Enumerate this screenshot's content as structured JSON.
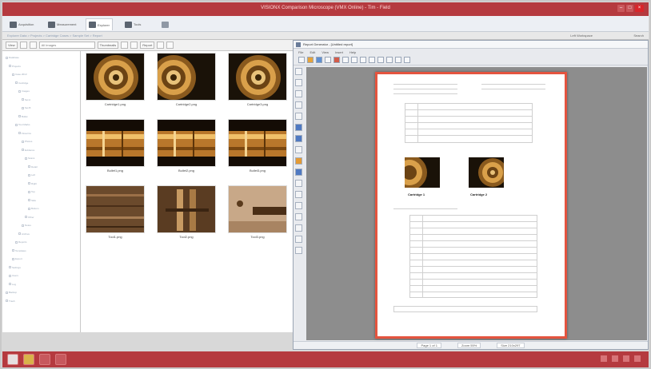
{
  "window": {
    "title": "VISIONX Comparison Microscope (VMX Online) - Tim - Field",
    "controls": [
      "–",
      "□",
      "×"
    ]
  },
  "ribbon": {
    "tabs": [
      {
        "label": "Acquisition",
        "active": false
      },
      {
        "label": "Measurement",
        "active": false
      },
      {
        "label": "Explorer",
        "active": true
      },
      {
        "label": "Tools",
        "active": false
      },
      {
        "label": "",
        "active": false
      }
    ]
  },
  "pathbar": {
    "path": "Explorer Data > Projects > Cartridge Cases > Sample Set > Report",
    "right1": "Left Workspace",
    "right2": "Search"
  },
  "toolbar": {
    "view_label": "View",
    "select_value": "All Images",
    "thumb_label": "Thumbnails",
    "report_label": "Report"
  },
  "tree": {
    "items": [
      "Database",
      "Projects",
      "Case 2013",
      "Cartridge",
      "Images",
      "Set A",
      "Set B",
      "Bullet",
      "Tool Marks",
      "Firearms",
      "Photos",
      "Evidence",
      "Scans",
      "Detail",
      "Left",
      "Right",
      "Top",
      "Side",
      "Bottom",
      "Other",
      "Notes",
      "Archive",
      "Reports",
      "Templates",
      "Export",
      "Settings",
      "Users",
      "Log",
      "Backup",
      "Trash"
    ]
  },
  "gallery": {
    "items": [
      {
        "caption": "Cartridge1.png",
        "kind": "cartridge"
      },
      {
        "caption": "Cartridge2.png",
        "kind": "cartridge2"
      },
      {
        "caption": "Cartridge3.png",
        "kind": "cartridge"
      },
      {
        "caption": "Bullet1.png",
        "kind": "bullet"
      },
      {
        "caption": "Bullet2.png",
        "kind": "bullet"
      },
      {
        "caption": "Bullet3.png",
        "kind": "bullet"
      },
      {
        "caption": "Tool1.png",
        "kind": "tool"
      },
      {
        "caption": "Tool2.png",
        "kind": "tool2"
      },
      {
        "caption": "Tool3.png",
        "kind": "tool3"
      }
    ]
  },
  "report": {
    "title": "Report Generator - [Untitled report]",
    "menu": [
      "File",
      "Edit",
      "View",
      "Insert",
      "Help"
    ],
    "image1_label": "Cartridge 1",
    "image2_label": "Cartridge 2",
    "status": {
      "page": "Page 1 of 1",
      "zoom": "Zoom 55%",
      "size": "Size 210x297"
    }
  },
  "colors": {
    "accent": "#b53a3f",
    "page_border": "#e4543f"
  }
}
